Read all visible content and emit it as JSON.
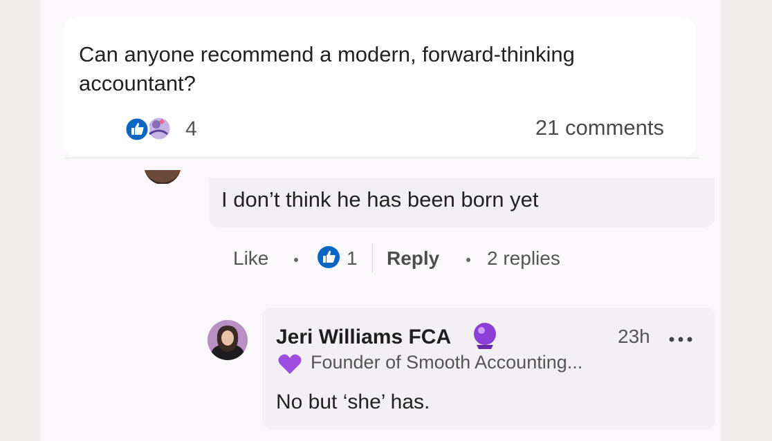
{
  "post": {
    "text_line1": "Can anyone recommend a modern, forward-thinking",
    "text_line2": "accountant?",
    "reaction_count": "4",
    "comments_label": "21 comments"
  },
  "comment": {
    "text": "I don’t think he has been born yet",
    "actions": {
      "like_label": "Like",
      "like_count": "1",
      "reply_label": "Reply",
      "replies_label": "2 replies"
    }
  },
  "reply": {
    "author": "Jeri Williams FCA",
    "time": "23h",
    "headline": "Founder of Smooth Accounting...",
    "text": "No but ‘she’ has."
  },
  "icons": {
    "like": "thumbs-up-icon",
    "support": "support-icon",
    "heart": "purple-heart-icon",
    "crystal_ball": "crystal-ball-icon",
    "more": "more-options-icon"
  },
  "colors": {
    "like_blue": "#0a66c2",
    "support_purple": "#b59cd9",
    "heart_purple": "#9b4ee0"
  }
}
